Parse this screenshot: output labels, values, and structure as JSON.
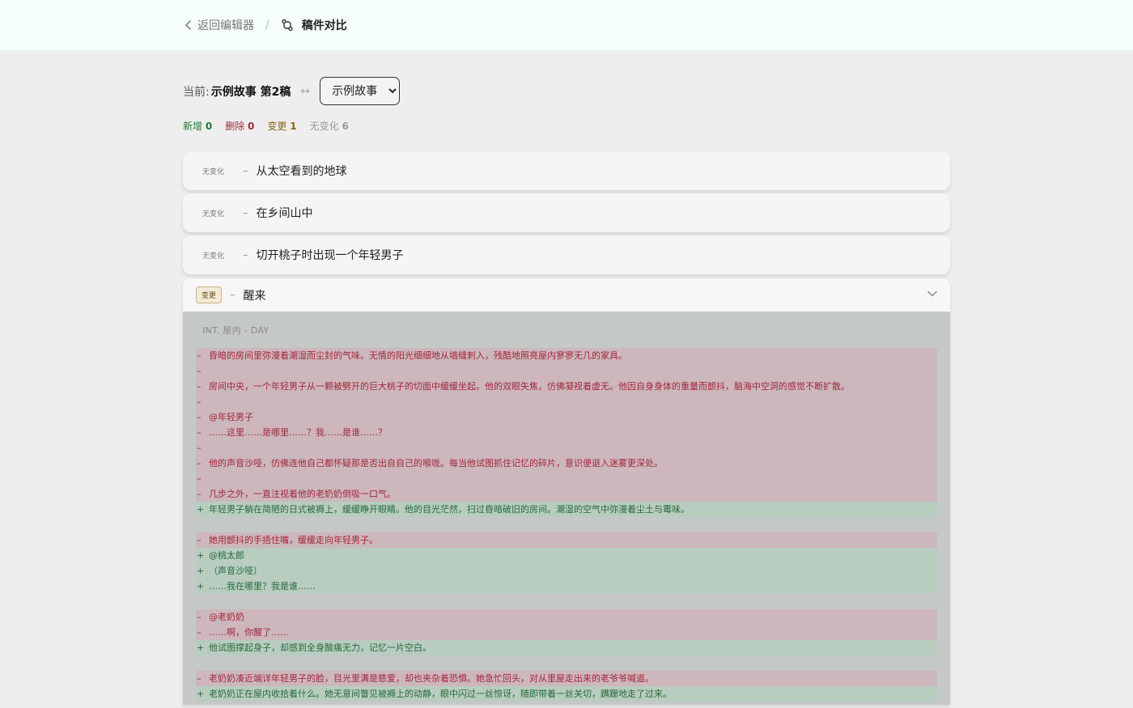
{
  "header": {
    "back_label": "返回编辑器",
    "separator": "/",
    "page_title": "稿件对比"
  },
  "compare": {
    "current_label": "当前:",
    "current_name": "示例故事 第2稿",
    "swap_symbol": "↔",
    "selected_draft": "示例故事"
  },
  "stats": {
    "added_label": "新增",
    "added": "0",
    "deleted_label": "删除",
    "deleted": "0",
    "changed_label": "变更",
    "changed": "1",
    "unchanged_label": "无变化",
    "unchanged": "6"
  },
  "scenes": [
    {
      "status": "无变化",
      "dash": "–",
      "title": "从太空看到的地球"
    },
    {
      "status": "无变化",
      "dash": "–",
      "title": "在乡间山中"
    },
    {
      "status": "无变化",
      "dash": "–",
      "title": "切开桃子时出现一个年轻男子"
    }
  ],
  "changed_scene": {
    "status": "变更",
    "dash": "–",
    "title": "醒来",
    "heading": "INT. 屋内 - DAY",
    "lines": [
      {
        "type": "del",
        "mark": "–",
        "text": "昏暗的房间里弥漫着潮湿而尘封的气味。无情的阳光细细地从墙缝刺入，残酷地照亮屋内寥寥无几的家具。"
      },
      {
        "type": "del",
        "mark": "–",
        "text": ""
      },
      {
        "type": "del",
        "mark": "–",
        "text": "房间中央，一个年轻男子从一颗被劈开的巨大桃子的切面中缓缓坐起。他的双眼失焦，仿佛凝视着虚无。他因自身身体的重量而颤抖，脑海中空洞的感觉不断扩散。"
      },
      {
        "type": "del",
        "mark": "–",
        "text": ""
      },
      {
        "type": "del",
        "mark": "–",
        "text": "@年轻男子"
      },
      {
        "type": "del",
        "mark": "–",
        "text": "……这里……是哪里……？我……是谁……？"
      },
      {
        "type": "del",
        "mark": "–",
        "text": ""
      },
      {
        "type": "del",
        "mark": "–",
        "text": "他的声音沙哑，仿佛连他自己都怀疑那是否出自自己的喉咙。每当他试图抓住记忆的碎片，意识便退入迷雾更深处。"
      },
      {
        "type": "del",
        "mark": "–",
        "text": ""
      },
      {
        "type": "del",
        "mark": "–",
        "text": "几步之外，一直注视着他的老奶奶倒吸一口气。"
      },
      {
        "type": "add",
        "mark": "+",
        "text": "年轻男子躺在简陋的日式被褥上，缓缓睁开眼睛。他的目光茫然，扫过昏暗破旧的房间。潮湿的空气中弥漫着尘土与霉味。"
      },
      {
        "type": "gap",
        "mark": "",
        "text": ""
      },
      {
        "type": "del",
        "mark": "–",
        "text": "她用颤抖的手捂住嘴，缓缓走向年轻男子。"
      },
      {
        "type": "add",
        "mark": "+",
        "text": "@桃太郎"
      },
      {
        "type": "add",
        "mark": "+",
        "text": "（声音沙哑）"
      },
      {
        "type": "add",
        "mark": "+",
        "text": "……我在哪里？我是谁……"
      },
      {
        "type": "gap",
        "mark": "",
        "text": ""
      },
      {
        "type": "del",
        "mark": "–",
        "text": "@老奶奶"
      },
      {
        "type": "del",
        "mark": "–",
        "text": "……啊，你醒了……"
      },
      {
        "type": "add",
        "mark": "+",
        "text": "他试图撑起身子，却感到全身酸痛无力，记忆一片空白。"
      },
      {
        "type": "gap",
        "mark": "",
        "text": ""
      },
      {
        "type": "del",
        "mark": "–",
        "text": "老奶奶凑近端详年轻男子的脸，目光里满是慈爱，却也夹杂着恐惧。她急忙回头，对从里屋走出来的老爷爷喊道。"
      },
      {
        "type": "add",
        "mark": "+",
        "text": "老奶奶正在屋内收拾着什么。她无意间瞥见被褥上的动静，眼中闪过一丝惊讶，随即带着一丝关切，蹒跚地走了过来。"
      }
    ]
  }
}
